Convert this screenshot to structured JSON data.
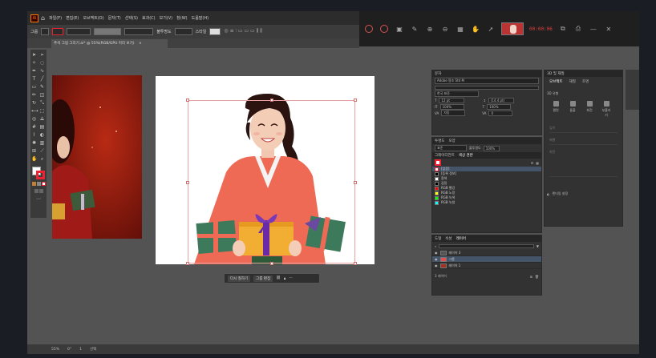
{
  "menubar": {
    "items": [
      "파일(F)",
      "편집(E)",
      "오브젝트(O)",
      "문자(T)",
      "선택(S)",
      "효과(C)",
      "보기(V)",
      "창(W)",
      "도움말(H)"
    ]
  },
  "control_bar": {
    "object_label": "그룹",
    "opacity_label": "불투명도",
    "opacity_value": "100%",
    "style_label": "스타일"
  },
  "recorder": {
    "timer": "00:00:06"
  },
  "document_tab": {
    "title": "추석 그림 그리기.ai* @ 55%(RGB/GPU 미리 보기)",
    "close": "×"
  },
  "context_bar": {
    "recolor_label": "다시 칠하기",
    "isolate_label": "그룹 편집"
  },
  "status_bar": {
    "zoom": "55%",
    "angle": "0°",
    "artboard": "1",
    "tool": "선택"
  },
  "character_panel": {
    "tab": "문자",
    "font": "Adobe 명조 Std M",
    "size": "12 pt",
    "leading": "(14.4 pt)",
    "scale_h": "100%",
    "scale_v": "100%",
    "tracking": "0",
    "kerning": "자동",
    "language": "한국 표준"
  },
  "swatches_panel": {
    "tabs": [
      "투명도",
      "모양",
      "그레이디언트",
      "색상 견본"
    ],
    "blend_mode": "표준",
    "opacity_label": "불투명도",
    "opacity_value": "100%",
    "items": [
      {
        "name": "[없음]",
        "color": "#ffffff"
      },
      {
        "name": "[등록 정보]",
        "color": "#000000"
      },
      {
        "name": "흰색",
        "color": "#ffffff"
      },
      {
        "name": "검정",
        "color": "#000000"
      },
      {
        "name": "RGB 빨강",
        "color": "#ff0000"
      },
      {
        "name": "RGB 노랑",
        "color": "#ffff00"
      },
      {
        "name": "RGB 녹색",
        "color": "#00ff00"
      },
      {
        "name": "RGB 녹청",
        "color": "#00ffff"
      }
    ]
  },
  "layers_panel": {
    "tabs": [
      "도형",
      "속성",
      "레이어"
    ],
    "items": [
      {
        "name": "레이어 3",
        "thumb": "#555555"
      },
      {
        "name": "그룹",
        "thumb": "#e05050"
      },
      {
        "name": "레이어 1",
        "thumb": "#a03020"
      }
    ],
    "count": "3 레이어"
  },
  "panel_3d": {
    "title": "3D 및 재질",
    "tabs": [
      "오브젝트",
      "재질",
      "조명"
    ],
    "section": "3D 유형",
    "types": [
      "평면",
      "돌출",
      "회전",
      "부풀리기"
    ],
    "depth_label": "깊이",
    "bevel_label": "베벨",
    "rotation_label": "회전",
    "render_label": "렌더링 설정"
  }
}
